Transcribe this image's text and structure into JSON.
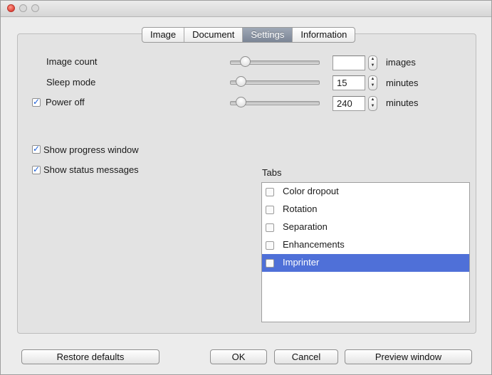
{
  "tabs": [
    "Image",
    "Document",
    "Settings",
    "Information"
  ],
  "selected_tab": "Settings",
  "settings": {
    "image_count": {
      "label": "Image count",
      "value": "",
      "unit": "images",
      "slider_value_fraction": 0.0
    },
    "sleep_mode": {
      "label": "Sleep mode",
      "value": "15",
      "unit": "minutes",
      "slider_value_fraction": 0.1
    },
    "power_off": {
      "label": "Power off",
      "checked": true,
      "value": "240",
      "unit": "minutes",
      "slider_value_fraction": 0.1
    }
  },
  "options": {
    "show_progress_window": {
      "label": "Show progress window",
      "checked": true
    },
    "show_status_messages": {
      "label": "Show status messages",
      "checked": true
    }
  },
  "tabs_list": {
    "title": "Tabs",
    "items": [
      {
        "label": "Color dropout",
        "checked": false,
        "selected": false
      },
      {
        "label": "Rotation",
        "checked": false,
        "selected": false
      },
      {
        "label": "Separation",
        "checked": false,
        "selected": false
      },
      {
        "label": "Enhancements",
        "checked": false,
        "selected": false
      },
      {
        "label": "Imprinter",
        "checked": false,
        "selected": true
      }
    ]
  },
  "buttons": {
    "restore_defaults": "Restore defaults",
    "ok": "OK",
    "cancel": "Cancel",
    "preview_window": "Preview window"
  },
  "colors": {
    "selection": "#4f70d8",
    "checkmark": "#1d5fd6",
    "close_button": "#e0443a"
  }
}
